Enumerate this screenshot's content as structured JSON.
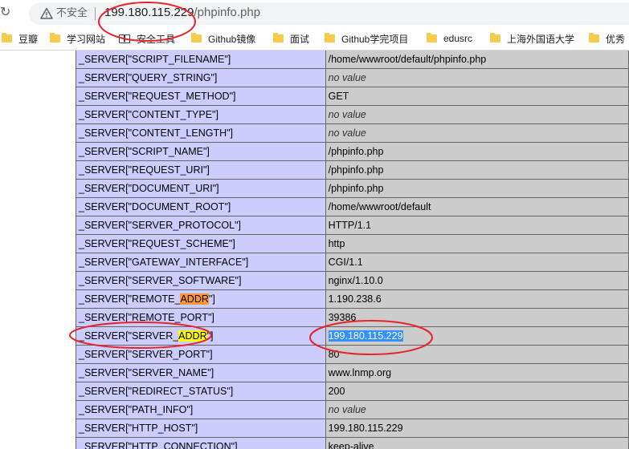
{
  "browser": {
    "security_label": "不安全",
    "url_host": "199.180.115.229",
    "url_path": "/phpinfo.php"
  },
  "bookmarks": [
    {
      "label": "豆瓣",
      "icon": "folder-icon"
    },
    {
      "label": "学习网站",
      "icon": "folder-icon"
    },
    {
      "label": "安全工具",
      "icon": "book-icon"
    },
    {
      "label": "Github镜像",
      "icon": "folder-icon"
    },
    {
      "label": "面试",
      "icon": "folder-icon"
    },
    {
      "label": "Github学完项目",
      "icon": "folder-icon"
    },
    {
      "label": "edusrc",
      "icon": "folder-icon"
    },
    {
      "label": "上海外国语大学",
      "icon": "folder-icon"
    },
    {
      "label": "优秀",
      "icon": "folder-icon"
    }
  ],
  "server_vars": [
    {
      "key": "_SERVER[\"SCRIPT_FILENAME\"]",
      "value": "/home/wwwroot/default/phpinfo.php"
    },
    {
      "key": "_SERVER[\"QUERY_STRING\"]",
      "value": "no value"
    },
    {
      "key": "_SERVER[\"REQUEST_METHOD\"]",
      "value": "GET"
    },
    {
      "key": "_SERVER[\"CONTENT_TYPE\"]",
      "value": "no value"
    },
    {
      "key": "_SERVER[\"CONTENT_LENGTH\"]",
      "value": "no value"
    },
    {
      "key": "_SERVER[\"SCRIPT_NAME\"]",
      "value": "/phpinfo.php"
    },
    {
      "key": "_SERVER[\"REQUEST_URI\"]",
      "value": "/phpinfo.php"
    },
    {
      "key": "_SERVER[\"DOCUMENT_URI\"]",
      "value": "/phpinfo.php"
    },
    {
      "key": "_SERVER[\"DOCUMENT_ROOT\"]",
      "value": "/home/wwwroot/default"
    },
    {
      "key": "_SERVER[\"SERVER_PROTOCOL\"]",
      "value": "HTTP/1.1"
    },
    {
      "key": "_SERVER[\"REQUEST_SCHEME\"]",
      "value": "http"
    },
    {
      "key": "_SERVER[\"GATEWAY_INTERFACE\"]",
      "value": "CGI/1.1"
    },
    {
      "key": "_SERVER[\"SERVER_SOFTWARE\"]",
      "value": "nginx/1.10.0"
    },
    {
      "key": "_SERVER[\"REMOTE_ADDR\"]",
      "value": "1.190.238.6"
    },
    {
      "key": "_SERVER[\"REMOTE_PORT\"]",
      "value": "39386"
    },
    {
      "key": "_SERVER[\"SERVER_ADDR\"]",
      "value": "199.180.115.229"
    },
    {
      "key": "_SERVER[\"SERVER_PORT\"]",
      "value": "80"
    },
    {
      "key": "_SERVER[\"SERVER_NAME\"]",
      "value": "www.lnmp.org"
    },
    {
      "key": "_SERVER[\"REDIRECT_STATUS\"]",
      "value": "200"
    },
    {
      "key": "_SERVER[\"PATH_INFO\"]",
      "value": "no value"
    },
    {
      "key": "_SERVER[\"HTTP_HOST\"]",
      "value": "199.180.115.229"
    },
    {
      "key": "_SERVER[\"HTTP_CONNECTION\"]",
      "value": "keep-alive"
    }
  ],
  "find_highlight": {
    "term": "ADDR",
    "current_color": "#ff9632",
    "match_color": "#ffff00"
  },
  "selection_color": "#3390ff",
  "annotation_color": "#e8232a"
}
